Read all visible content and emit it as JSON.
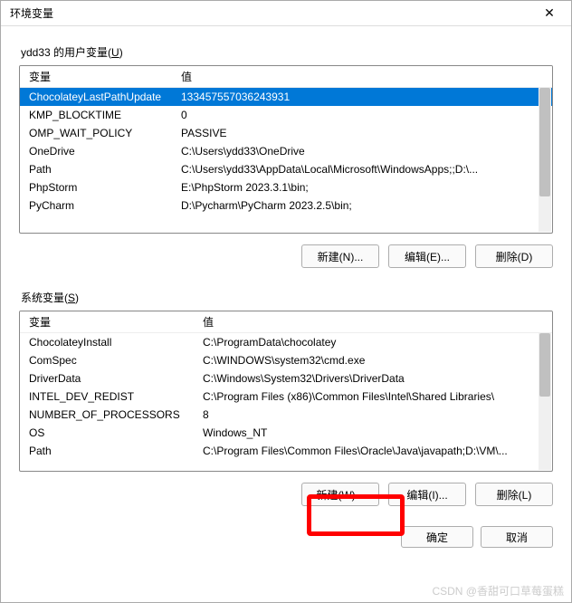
{
  "titlebar": {
    "title": "环境变量",
    "close_icon": "✕"
  },
  "user_section": {
    "label_prefix": "ydd33 的用户变量(",
    "label_key": "U",
    "label_suffix": ")",
    "header_var": "变量",
    "header_val": "值",
    "rows": [
      {
        "var": "ChocolateyLastPathUpdate",
        "val": "133457557036243931"
      },
      {
        "var": "KMP_BLOCKTIME",
        "val": "0"
      },
      {
        "var": "OMP_WAIT_POLICY",
        "val": "PASSIVE"
      },
      {
        "var": "OneDrive",
        "val": "C:\\Users\\ydd33\\OneDrive"
      },
      {
        "var": "Path",
        "val": "C:\\Users\\ydd33\\AppData\\Local\\Microsoft\\WindowsApps;;D:\\..."
      },
      {
        "var": "PhpStorm",
        "val": "E:\\PhpStorm 2023.3.1\\bin;"
      },
      {
        "var": "PyCharm",
        "val": "D:\\Pycharm\\PyCharm 2023.2.5\\bin;"
      }
    ],
    "buttons": {
      "new": "新建(N)...",
      "edit": "编辑(E)...",
      "delete": "删除(D)"
    }
  },
  "system_section": {
    "label_prefix": "系统变量(",
    "label_key": "S",
    "label_suffix": ")",
    "header_var": "变量",
    "header_val": "值",
    "rows": [
      {
        "var": "ChocolateyInstall",
        "val": "C:\\ProgramData\\chocolatey"
      },
      {
        "var": "ComSpec",
        "val": "C:\\WINDOWS\\system32\\cmd.exe"
      },
      {
        "var": "DriverData",
        "val": "C:\\Windows\\System32\\Drivers\\DriverData"
      },
      {
        "var": "INTEL_DEV_REDIST",
        "val": "C:\\Program Files (x86)\\Common Files\\Intel\\Shared Libraries\\"
      },
      {
        "var": "NUMBER_OF_PROCESSORS",
        "val": "8"
      },
      {
        "var": "OS",
        "val": "Windows_NT"
      },
      {
        "var": "Path",
        "val": "C:\\Program Files\\Common Files\\Oracle\\Java\\javapath;D:\\VM\\..."
      }
    ],
    "buttons": {
      "new": "新建(W)...",
      "edit": "编辑(I)...",
      "delete": "删除(L)"
    }
  },
  "footer": {
    "ok": "确定",
    "cancel": "取消"
  },
  "watermark": "CSDN @香甜可口草莓蛋糕"
}
